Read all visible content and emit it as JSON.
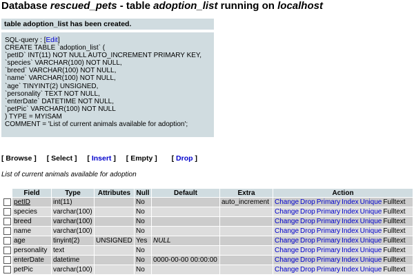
{
  "header": {
    "prefix": "Database ",
    "database": "rescued_pets",
    "middle": " - table ",
    "table": "adoption_list",
    "suffix": " running on ",
    "host": "localhost"
  },
  "message": "table adoption_list has been created.",
  "sql": {
    "label": "SQL-query : [",
    "edit_link": "Edit",
    "label_end": "]",
    "lines": [
      "CREATE TABLE `adoption_list` (",
      "`petID` INT(11) NOT NULL AUTO_INCREMENT PRIMARY KEY,",
      "`species` VARCHAR(100) NOT NULL,",
      "`breed` VARCHAR(100) NOT NULL,",
      "`name` VARCHAR(100) NOT NULL,",
      "`age` TINYINT(2) UNSIGNED,",
      "`personality` TEXT NOT NULL,",
      "`enterDate` DATETIME NOT NULL,",
      "`petPic` VARCHAR(100) NOT NULL",
      ") TYPE = MYISAM",
      "COMMENT = 'List of current animals available for adoption';"
    ]
  },
  "actions": {
    "browse": "Browse",
    "select": "Select",
    "insert": "Insert",
    "empty": "Empty",
    "drop": "Drop"
  },
  "table_comment": "List of current animals available for adoption",
  "structure": {
    "headers": [
      "Field",
      "Type",
      "Attributes",
      "Null",
      "Default",
      "Extra",
      "Action"
    ],
    "action_links": [
      "Change",
      "Drop",
      "Primary",
      "Index",
      "Unique",
      "Fulltext"
    ],
    "rows": [
      {
        "field": "petID",
        "type": "int(11)",
        "attributes": "",
        "null": "No",
        "default": "",
        "extra": "auto_increment"
      },
      {
        "field": "species",
        "type": "varchar(100)",
        "attributes": "",
        "null": "No",
        "default": "",
        "extra": ""
      },
      {
        "field": "breed",
        "type": "varchar(100)",
        "attributes": "",
        "null": "No",
        "default": "",
        "extra": ""
      },
      {
        "field": "name",
        "type": "varchar(100)",
        "attributes": "",
        "null": "No",
        "default": "",
        "extra": ""
      },
      {
        "field": "age",
        "type": "tinyint(2)",
        "attributes": "UNSIGNED",
        "null": "Yes",
        "default": "NULL",
        "extra": ""
      },
      {
        "field": "personality",
        "type": "text",
        "attributes": "",
        "null": "No",
        "default": "",
        "extra": ""
      },
      {
        "field": "enterDate",
        "type": "datetime",
        "attributes": "",
        "null": "No",
        "default": "0000-00-00 00:00:00",
        "extra": ""
      },
      {
        "field": "petPic",
        "type": "varchar(100)",
        "attributes": "",
        "null": "No",
        "default": "",
        "extra": ""
      }
    ]
  }
}
